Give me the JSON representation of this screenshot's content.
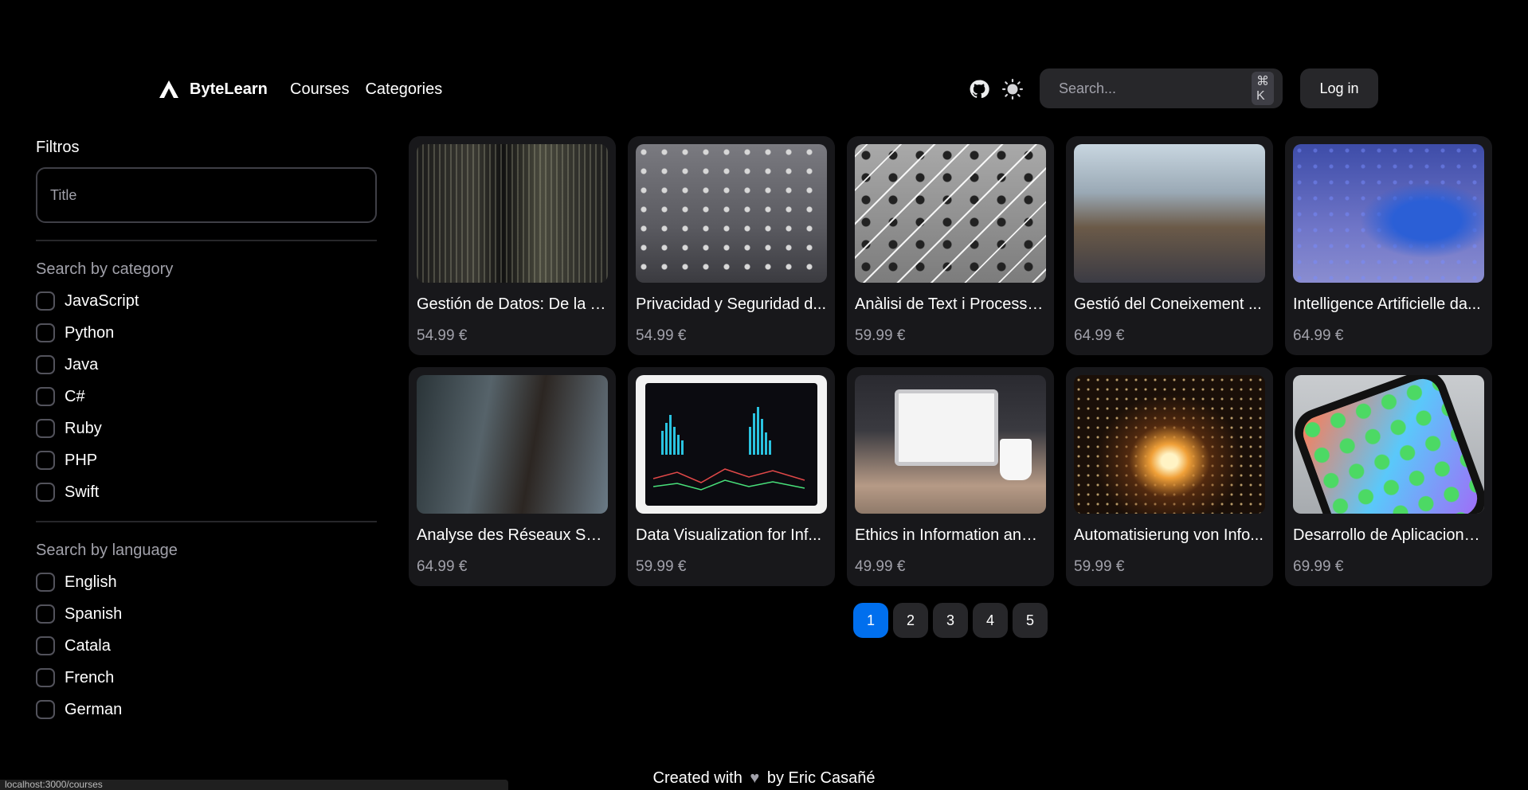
{
  "header": {
    "brand": "ByteLearn",
    "nav": [
      "Courses",
      "Categories"
    ],
    "search_placeholder": "Search...",
    "search_shortcut": "⌘ K",
    "login_label": "Log in"
  },
  "sidebar": {
    "filters_title": "Filtros",
    "title_placeholder": "Title",
    "category_title": "Search by category",
    "categories": [
      "JavaScript",
      "Python",
      "Java",
      "C#",
      "Ruby",
      "PHP",
      "Swift"
    ],
    "language_title": "Search by language",
    "languages": [
      "English",
      "Spanish",
      "Catala",
      "French",
      "German"
    ]
  },
  "courses": [
    {
      "title": "Gestión de Datos: De la T...",
      "price": "54.99 €"
    },
    {
      "title": "Privacidad y Seguridad d...",
      "price": "54.99 €"
    },
    {
      "title": "Anàlisi de Text i Processa...",
      "price": "59.99 €"
    },
    {
      "title": "Gestió del Coneixement ...",
      "price": "64.99 €"
    },
    {
      "title": "Intelligence Artificielle da...",
      "price": "64.99 €"
    },
    {
      "title": "Analyse des Réseaux Soci...",
      "price": "64.99 €"
    },
    {
      "title": "Data Visualization for Inf...",
      "price": "59.99 €"
    },
    {
      "title": "Ethics in Information and ...",
      "price": "49.99 €"
    },
    {
      "title": "Automatisierung von Info...",
      "price": "59.99 €"
    },
    {
      "title": "Desarrollo de Aplicacione...",
      "price": "69.99 €"
    }
  ],
  "pagination": {
    "pages": [
      "1",
      "2",
      "3",
      "4",
      "5"
    ],
    "active": "1"
  },
  "footer": {
    "prefix": "Created with",
    "suffix": "by Eric Casañé"
  },
  "status_bar": "localhost:3000/courses",
  "colors": {
    "background": "#000000",
    "accent": "#006FEE",
    "card": "#18181B",
    "muted": "#A1A1AA"
  },
  "icons": [
    "logo-icon",
    "github-icon",
    "theme-sun-icon",
    "search-icon",
    "heart-icon"
  ]
}
